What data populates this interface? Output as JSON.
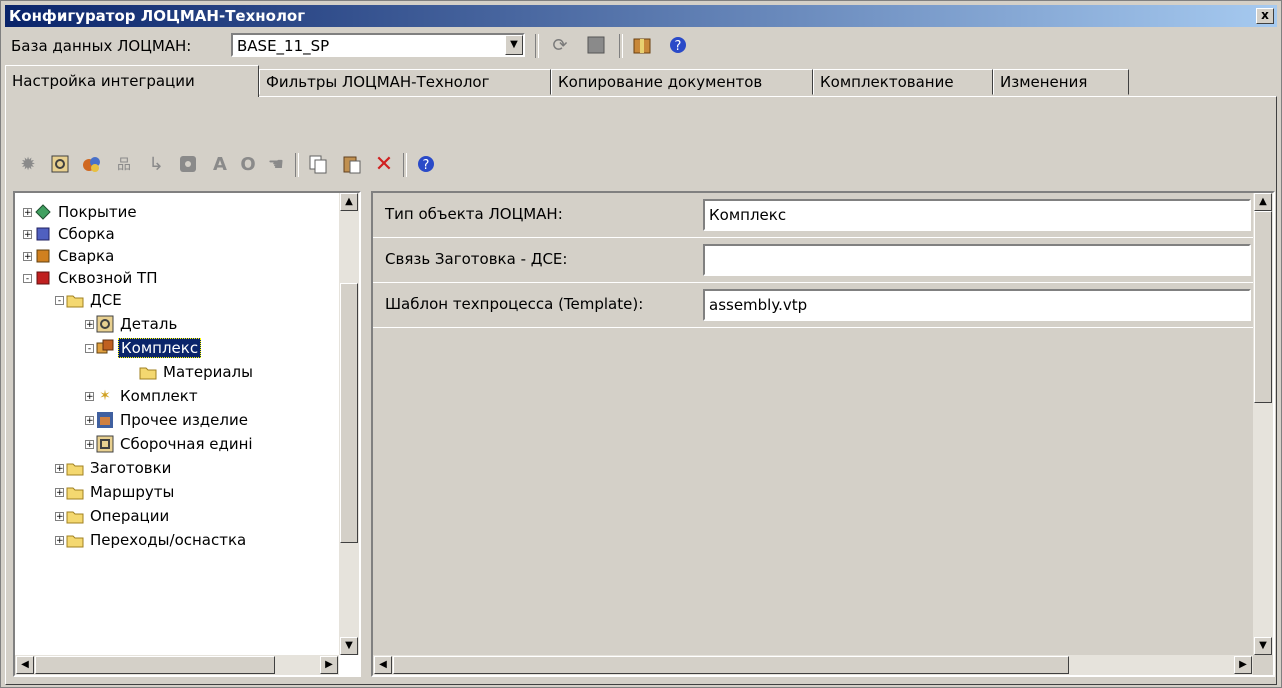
{
  "window": {
    "title": "Конфигуратор ЛОЦМАН-Технолог",
    "close_label": "x"
  },
  "database": {
    "label": "База данных ЛОЦМАН:",
    "value": "BASE_11_SP"
  },
  "toolbar1": {
    "icons": [
      "refresh-icon",
      "save-icon",
      "package-icon",
      "help-icon"
    ]
  },
  "tabs": [
    {
      "label": "Настройка интеграции",
      "active": true
    },
    {
      "label": "Фильтры ЛОЦМАН-Технолог",
      "active": false
    },
    {
      "label": "Копирование документов",
      "active": false
    },
    {
      "label": "Комплектование",
      "active": false
    },
    {
      "label": "Изменения",
      "active": false
    }
  ],
  "toolbar2": {
    "icons": [
      "gear-icon",
      "detail-icon",
      "group-icon",
      "hierarchy-icon",
      "link-icon",
      "record-icon",
      "text-icon",
      "circle-icon",
      "hand-icon",
      "copy-icon",
      "paste-icon",
      "delete-icon",
      "help-icon"
    ]
  },
  "tree": {
    "nodes": [
      {
        "label": "Покрытие",
        "level": 0,
        "pm": "+",
        "icon": "coating-icon"
      },
      {
        "label": "Сборка",
        "level": 0,
        "pm": "+",
        "icon": "assembly-icon"
      },
      {
        "label": "Сварка",
        "level": 0,
        "pm": "+",
        "icon": "welding-icon"
      },
      {
        "label": "Сквозной ТП",
        "level": 0,
        "pm": "-",
        "icon": "through-process-icon"
      },
      {
        "label": "ДСЕ",
        "level": 1,
        "pm": "-",
        "icon": "folder-icon"
      },
      {
        "label": "Деталь",
        "level": 2,
        "pm": "+",
        "icon": "part-icon"
      },
      {
        "label": "Комплекс",
        "level": 2,
        "pm": "-",
        "icon": "complex-icon",
        "selected": true
      },
      {
        "label": "Материалы",
        "level": 3,
        "pm": "",
        "icon": "folder-icon"
      },
      {
        "label": "Комплект",
        "level": 2,
        "pm": "+",
        "icon": "kit-icon"
      },
      {
        "label": "Прочее изделие",
        "level": 2,
        "pm": "+",
        "icon": "other-product-icon"
      },
      {
        "label": "Сборочная едині",
        "level": 2,
        "pm": "+",
        "icon": "assembly-unit-icon"
      },
      {
        "label": "Заготовки",
        "level": 1,
        "pm": "+",
        "icon": "folder-icon"
      },
      {
        "label": "Маршруты",
        "level": 1,
        "pm": "+",
        "icon": "folder-icon"
      },
      {
        "label": "Операции",
        "level": 1,
        "pm": "+",
        "icon": "folder-icon"
      },
      {
        "label": "Переходы/оснастка",
        "level": 1,
        "pm": "+",
        "icon": "folder-icon"
      }
    ]
  },
  "properties": [
    {
      "label": "Тип объекта ЛОЦМАН:",
      "value": "Комплекс"
    },
    {
      "label": "Связь Заготовка - ДСЕ:",
      "value": ""
    },
    {
      "label": "Шаблон техпроцесса (Template):",
      "value": "assembly.vtp"
    }
  ],
  "colors": {
    "title_start": "#0a246a",
    "title_end": "#a6caf0",
    "selection": "#0a246a",
    "face": "#d4d0c8"
  }
}
